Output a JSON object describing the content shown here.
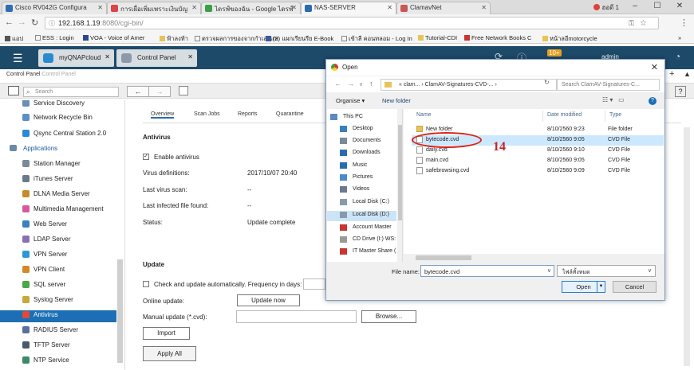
{
  "browser": {
    "tabs": [
      {
        "label": "Cisco RV042G Configura",
        "color": "#2f6db5"
      },
      {
        "label": "การเผื่อเพิ่มเพราะเงินบัญ",
        "color": "#d44"
      },
      {
        "label": "ไดรฟ์ของฉัน - Google ไดรฟ์",
        "color": "#3a9e4a"
      },
      {
        "label": "NAS-SERVER",
        "color": "#2a6cb0"
      },
      {
        "label": "ClamavNet",
        "color": "#c55"
      }
    ],
    "user": "ฮอดี 1",
    "address": {
      "host": "192.168.1.19",
      "rest": ":8080/cgi-bin/"
    },
    "bookmarks": [
      {
        "label": "แอป"
      },
      {
        "label": "ESS : Login"
      },
      {
        "label": "VOA - Voice of Amer"
      },
      {
        "label": "ฟ้าลงท้า"
      },
      {
        "label": "ตรวจผลการของจากกำเลยแท"
      },
      {
        "label": "(3) แผกเรียนรีย E-Book"
      },
      {
        "label": "เข้าลี คอนทลอม - Log In"
      },
      {
        "label": "Tutorial-CDI"
      },
      {
        "label": "Free Network Books C"
      },
      {
        "label": "หน้าลอีmotorcycle"
      }
    ]
  },
  "qnap": {
    "tabs": [
      {
        "label": "myQNAPcloud"
      },
      {
        "label": "Control Panel"
      }
    ],
    "badge": "10+",
    "user": "admin"
  },
  "control_panel": {
    "title": "Control Panel",
    "subtitle": "Control Panel",
    "search_placeholder": "Search"
  },
  "sidebar": {
    "items_top": [
      {
        "label": "Service Discovery",
        "color": "#6a8fb5"
      },
      {
        "label": "Network Recycle Bin",
        "color": "#5b8fc9"
      },
      {
        "label": "Qsync Central Station 2.0",
        "color": "#2a89d8"
      }
    ],
    "group": "Applications",
    "items": [
      {
        "label": "Station Manager",
        "color": "#7a8a9a"
      },
      {
        "label": "iTunes Server",
        "color": "#6b7b8b"
      },
      {
        "label": "DLNA Media Server",
        "color": "#c88a2a"
      },
      {
        "label": "Multimedia Management",
        "color": "#d65a9a"
      },
      {
        "label": "Web Server",
        "color": "#3a7fc0"
      },
      {
        "label": "LDAP Server",
        "color": "#8a6fb5"
      },
      {
        "label": "VPN Server",
        "color": "#2a9ad0"
      },
      {
        "label": "VPN Client",
        "color": "#d08a2a"
      },
      {
        "label": "SQL server",
        "color": "#4aa84a"
      },
      {
        "label": "Syslog Server",
        "color": "#c8a83a"
      },
      {
        "label": "Antivirus",
        "color": "#e04a3a"
      },
      {
        "label": "RADIUS Server",
        "color": "#5a6fa0"
      },
      {
        "label": "TFTP Server",
        "color": "#4a5a6a"
      },
      {
        "label": "NTP Service",
        "color": "#3a8a6a"
      }
    ],
    "selected": "Antivirus"
  },
  "antivirus": {
    "tabs": [
      "Overview",
      "Scan Jobs",
      "Reports",
      "Quarantine"
    ],
    "section": "Antivirus",
    "enable_label": "Enable antivirus",
    "rows": [
      {
        "label": "Virus definitions:",
        "value": "2017/10/07 20:40"
      },
      {
        "label": "Last virus scan:",
        "value": "--"
      },
      {
        "label": "Last infected file found:",
        "value": "--"
      },
      {
        "label": "Status:",
        "value": "Update complete"
      }
    ],
    "update_section": "Update",
    "auto_update_label": "Check and update automatically. Frequency in days:",
    "online_update_label": "Online update:",
    "update_now": "Update now",
    "manual_update_label": "Manual update (*.cvd):",
    "browse": "Browse...",
    "import": "Import",
    "apply_all": "Apply All"
  },
  "dialog": {
    "title": "Open",
    "path": "« clam... › ClamAV-Signatures-CVD-... ›",
    "search_placeholder": "Search ClamAV-Signatures-C...",
    "organise": "Organise ▾",
    "new_folder": "New folder",
    "nav": [
      {
        "label": "This PC",
        "color": "#5a8ac0"
      },
      {
        "label": "Desktop",
        "color": "#3a7fc0"
      },
      {
        "label": "Documents",
        "color": "#7a8a9a"
      },
      {
        "label": "Downloads",
        "color": "#2a6cb0"
      },
      {
        "label": "Music",
        "color": "#2a6cb0"
      },
      {
        "label": "Pictures",
        "color": "#4a8ad0"
      },
      {
        "label": "Videos",
        "color": "#6a7a8a"
      },
      {
        "label": "Local Disk (C:)",
        "color": "#8a9aaa"
      },
      {
        "label": "Local Disk (D:)",
        "color": "#8a9aaa"
      },
      {
        "label": "Account Master",
        "color": "#c33"
      },
      {
        "label": "CD Drive (I:) WS:",
        "color": "#999"
      },
      {
        "label": "IT Master Share (",
        "color": "#c33"
      }
    ],
    "nav_selected": "Local Disk (D:)",
    "columns": [
      "Name",
      "Date modified",
      "Type"
    ],
    "files": [
      {
        "name": "New folder",
        "date": "8/10/2560 9:23",
        "type": "File folder",
        "folder": true
      },
      {
        "name": "bytecode.cvd",
        "date": "8/10/2560 9:05",
        "type": "CVD File",
        "folder": false
      },
      {
        "name": "daily.cvd",
        "date": "8/10/2560 9:10",
        "type": "CVD File",
        "folder": false
      },
      {
        "name": "main.cvd",
        "date": "8/10/2560 9:05",
        "type": "CVD File",
        "folder": false
      },
      {
        "name": "safebrowsing.cvd",
        "date": "8/10/2560 9:09",
        "type": "CVD File",
        "folder": false
      }
    ],
    "selected_file": "bytecode.cvd",
    "annotation": "14",
    "file_name_label": "File name:",
    "file_name_value": "bytecode.cvd",
    "file_type_value": "ไฟล์ทั้งหมด",
    "open": "Open",
    "cancel": "Cancel"
  }
}
